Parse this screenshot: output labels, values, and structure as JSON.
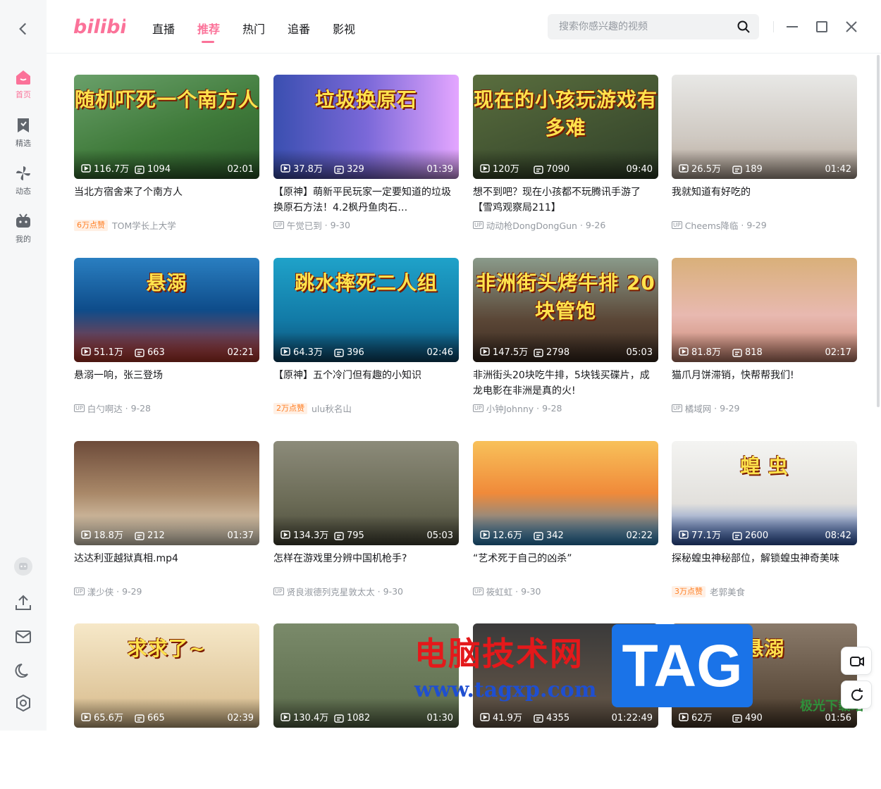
{
  "sidebar": {
    "items": [
      {
        "label": "首页",
        "icon": "home-icon",
        "active": true
      },
      {
        "label": "精选",
        "icon": "bookmark-icon",
        "active": false
      },
      {
        "label": "动态",
        "icon": "pinwheel-icon",
        "active": false
      },
      {
        "label": "我的",
        "icon": "tv-icon",
        "active": false
      }
    ],
    "bottom_icons": [
      "avatar-icon",
      "upload-icon",
      "mail-icon",
      "moon-icon",
      "settings-icon"
    ]
  },
  "header": {
    "logo_text": "bilibili",
    "tabs": [
      {
        "label": "直播",
        "active": false
      },
      {
        "label": "推荐",
        "active": true
      },
      {
        "label": "热门",
        "active": false
      },
      {
        "label": "追番",
        "active": false
      },
      {
        "label": "影视",
        "active": false
      }
    ],
    "search_placeholder": "搜索你感兴趣的视频"
  },
  "colors": {
    "accent": "#fb7299",
    "text": "#18191c",
    "muted": "#9499a0"
  },
  "videos": [
    {
      "views": "116.7万",
      "danmaku": "1094",
      "duration": "02:01",
      "title": "当北方宿舍来了个南方人",
      "badge": "6万点赞",
      "uploader": "TOM学长上大学",
      "date": "",
      "overlay": "随机吓死一个南方人"
    },
    {
      "views": "37.8万",
      "danmaku": "329",
      "duration": "01:39",
      "title": "【原神】萌新平民玩家一定要知道的垃圾换原石方法！4.2枫丹鱼肉石…",
      "badge": "",
      "uploader": "午觉已到",
      "date": "9-30",
      "overlay": "垃圾换原石"
    },
    {
      "views": "120万",
      "danmaku": "7090",
      "duration": "09:40",
      "title": "想不到吧？现在小孩都不玩腾讯手游了【雪鸡观察局211】",
      "badge": "",
      "uploader": "动动枪DongDongGun",
      "date": "9-26",
      "overlay": "现在的小孩玩游戏有多难"
    },
    {
      "views": "26.5万",
      "danmaku": "189",
      "duration": "01:42",
      "title": "我就知道有好吃的",
      "badge": "",
      "uploader": "Cheems降临",
      "date": "9-29",
      "overlay": ""
    },
    {
      "views": "51.1万",
      "danmaku": "663",
      "duration": "02:21",
      "title": "悬溺一响，张三登场",
      "badge": "",
      "uploader": "白勺啊达",
      "date": "9-28",
      "overlay": "悬溺"
    },
    {
      "views": "64.3万",
      "danmaku": "396",
      "duration": "02:46",
      "title": "【原神】五个冷门但有趣的小知识",
      "badge": "2万点赞",
      "uploader": "ulu秋名山",
      "date": "",
      "overlay": "跳水摔死二人组"
    },
    {
      "views": "147.5万",
      "danmaku": "2798",
      "duration": "05:03",
      "title": "非洲街头20块吃牛排，5块钱买碟片，成龙电影在非洲是真的火!",
      "badge": "",
      "uploader": "小钟Johnny",
      "date": "9-28",
      "overlay": "非洲街头烤牛排 20块管饱"
    },
    {
      "views": "81.8万",
      "danmaku": "818",
      "duration": "02:17",
      "title": "猫爪月饼滞销，快帮帮我们!",
      "badge": "",
      "uploader": "橘域网",
      "date": "9-29",
      "overlay": ""
    },
    {
      "views": "18.8万",
      "danmaku": "212",
      "duration": "01:37",
      "title": "达达利亚越狱真相.mp4",
      "badge": "",
      "uploader": "漾少侠",
      "date": "9-29",
      "overlay": ""
    },
    {
      "views": "134.3万",
      "danmaku": "795",
      "duration": "05:03",
      "title": "怎样在游戏里分辨中国机枪手?",
      "badge": "",
      "uploader": "贤良淑德列克星敦太太",
      "date": "9-30",
      "overlay": ""
    },
    {
      "views": "12.6万",
      "danmaku": "342",
      "duration": "02:22",
      "title": "“艺术死于自己的凶杀”",
      "badge": "",
      "uploader": "筱虹虹",
      "date": "9-30",
      "overlay": ""
    },
    {
      "views": "77.1万",
      "danmaku": "2600",
      "duration": "08:42",
      "title": "探秘蝗虫神秘部位，解锁蝗虫神奇美味",
      "badge": "3万点赞",
      "uploader": "老郭美食",
      "date": "",
      "overlay": "蝗 虫"
    },
    {
      "views": "65.6万",
      "danmaku": "665",
      "duration": "02:39",
      "title": "",
      "badge": "",
      "uploader": "",
      "date": "",
      "overlay": "求求了~"
    },
    {
      "views": "130.4万",
      "danmaku": "1082",
      "duration": "01:30",
      "title": "",
      "badge": "",
      "uploader": "",
      "date": "",
      "overlay": ""
    },
    {
      "views": "41.9万",
      "danmaku": "4355",
      "duration": "01:22:49",
      "title": "",
      "badge": "",
      "uploader": "",
      "date": "",
      "overlay": ""
    },
    {
      "views": "62万",
      "danmaku": "490",
      "duration": "01:56",
      "title": "",
      "badge": "",
      "uploader": "",
      "date": "",
      "overlay": "悬溺"
    }
  ],
  "watermark": {
    "line1": "电脑技术网",
    "line2": "www.tagxp.com",
    "tag": "TAG",
    "corner": "极光下载站"
  }
}
